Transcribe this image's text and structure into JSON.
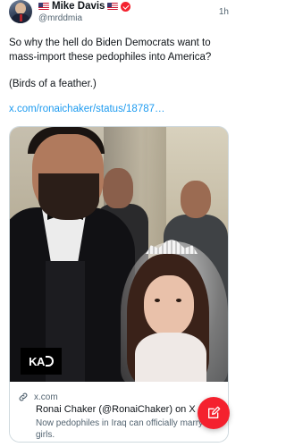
{
  "post": {
    "author_name": "Mike Davis",
    "author_handle": "@mrddmia",
    "timestamp": "1h",
    "text_line1": "So why the hell do Biden Democrats want to mass-import these pedophiles into America?",
    "text_line2": "(Birds of a feather.)",
    "link_text": "x.com/ronaichaker/status/18787…"
  },
  "link_card": {
    "watermark": "KA",
    "domain": "x.com",
    "title": "Ronai Chaker (@RonaiChaker) on X",
    "description": "Now pedophiles in Iraq can officially marry little girls."
  },
  "icons": {
    "flag": "us-flag-icon",
    "verified": "verified-badge-icon",
    "link": "link-icon",
    "compose": "compose-icon"
  },
  "colors": {
    "accent_link": "#1d9bf0",
    "fab": "#f4212e",
    "verified": "#f4212e",
    "secondary_text": "#536471"
  }
}
